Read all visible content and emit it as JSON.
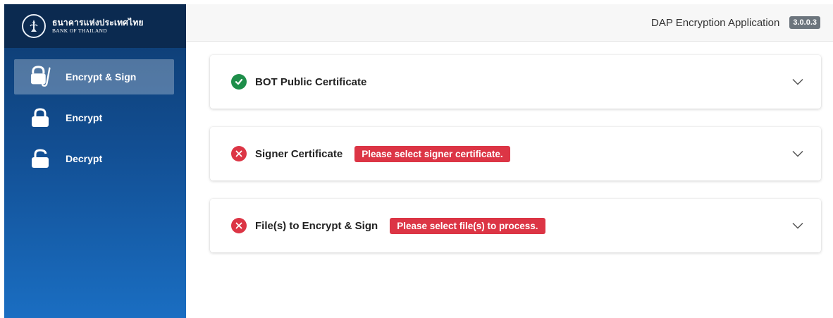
{
  "sidebar": {
    "logo": {
      "thai_name": "ธนาคารแห่งประเทศไทย",
      "english_name": "BANK OF THAILAND"
    },
    "items": [
      {
        "label": "Encrypt & Sign",
        "icon": "lock-sign-icon",
        "active": true
      },
      {
        "label": "Encrypt",
        "icon": "lock-icon",
        "active": false
      },
      {
        "label": "Decrypt",
        "icon": "unlock-icon",
        "active": false
      }
    ]
  },
  "header": {
    "app_title": "DAP Encryption Application",
    "version": "3.0.0.3"
  },
  "cards": [
    {
      "title": "BOT Public Certificate",
      "status": "ok",
      "error": ""
    },
    {
      "title": "Signer Certificate",
      "status": "error",
      "error": "Please select signer certificate."
    },
    {
      "title": "File(s) to Encrypt & Sign",
      "status": "error",
      "error": "Please select file(s) to process."
    }
  ],
  "colors": {
    "sidebar_top": "#0d3a6e",
    "sidebar_bottom": "#1a6ec2",
    "success": "#1e8e4a",
    "danger": "#dc3545",
    "badge": "#6c757d"
  }
}
